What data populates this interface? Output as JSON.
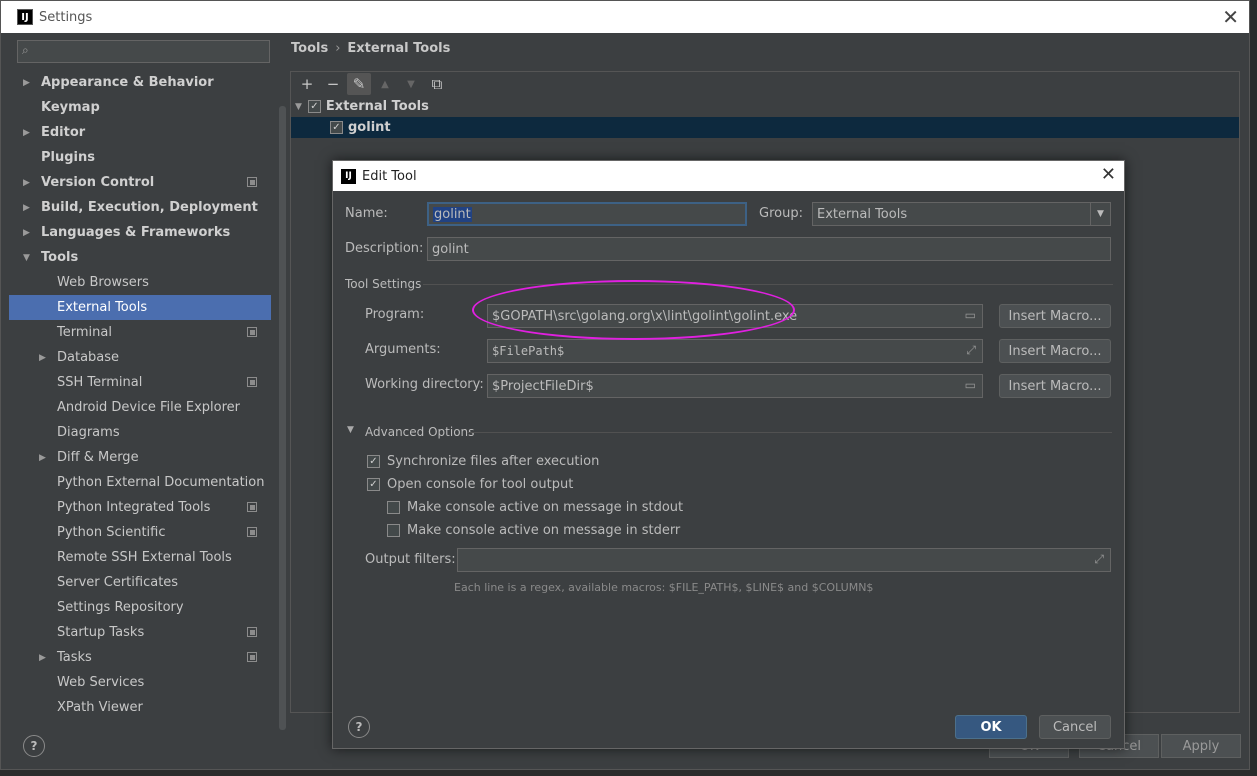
{
  "window": {
    "title": "Settings",
    "app_icon": "IJ"
  },
  "search": {
    "placeholder": ""
  },
  "sidebar": {
    "items": [
      {
        "label": "Appearance & Behavior",
        "level": 0,
        "bold": true,
        "arrow": "right"
      },
      {
        "label": "Keymap",
        "level": 0,
        "bold": true
      },
      {
        "label": "Editor",
        "level": 0,
        "bold": true,
        "arrow": "right"
      },
      {
        "label": "Plugins",
        "level": 0,
        "bold": true
      },
      {
        "label": "Version Control",
        "level": 0,
        "bold": true,
        "arrow": "right",
        "project": true
      },
      {
        "label": "Build, Execution, Deployment",
        "level": 0,
        "bold": true,
        "arrow": "right"
      },
      {
        "label": "Languages & Frameworks",
        "level": 0,
        "bold": true,
        "arrow": "right"
      },
      {
        "label": "Tools",
        "level": 0,
        "bold": true,
        "arrow": "down"
      },
      {
        "label": "Web Browsers",
        "level": 1
      },
      {
        "label": "External Tools",
        "level": 1,
        "selected": true
      },
      {
        "label": "Terminal",
        "level": 1,
        "project": true
      },
      {
        "label": "Database",
        "level": 1,
        "arrow": "right"
      },
      {
        "label": "SSH Terminal",
        "level": 1,
        "project": true
      },
      {
        "label": "Android Device File Explorer",
        "level": 1
      },
      {
        "label": "Diagrams",
        "level": 1
      },
      {
        "label": "Diff & Merge",
        "level": 1,
        "arrow": "right"
      },
      {
        "label": "Python External Documentation",
        "level": 1
      },
      {
        "label": "Python Integrated Tools",
        "level": 1,
        "project": true
      },
      {
        "label": "Python Scientific",
        "level": 1,
        "project": true
      },
      {
        "label": "Remote SSH External Tools",
        "level": 1
      },
      {
        "label": "Server Certificates",
        "level": 1
      },
      {
        "label": "Settings Repository",
        "level": 1
      },
      {
        "label": "Startup Tasks",
        "level": 1,
        "project": true
      },
      {
        "label": "Tasks",
        "level": 1,
        "arrow": "right",
        "project": true
      },
      {
        "label": "Web Services",
        "level": 1
      },
      {
        "label": "XPath Viewer",
        "level": 1
      }
    ]
  },
  "breadcrumb": {
    "parent": "Tools",
    "separator": "›",
    "current": "External Tools"
  },
  "toolbar": {
    "add": "+",
    "remove": "−",
    "edit": "✎",
    "up": "▲",
    "down": "▼",
    "copy": "⧉"
  },
  "tools_tree": {
    "group": {
      "label": "External Tools",
      "checked": true
    },
    "items": [
      {
        "label": "golint",
        "checked": true,
        "selected": true
      }
    ]
  },
  "bottom": {
    "ok": "OK",
    "cancel": "Cancel",
    "apply": "Apply",
    "help": "?"
  },
  "dialog": {
    "title": "Edit Tool",
    "name_label": "Name:",
    "name_value": "golint",
    "group_label": "Group:",
    "group_value": "External Tools",
    "description_label": "Description:",
    "description_value": "golint",
    "tool_settings_title": "Tool Settings",
    "program_label": "Program:",
    "program_value": "$GOPATH\\src\\golang.org\\x\\lint\\golint\\golint.exe",
    "arguments_label": "Arguments:",
    "arguments_value": "$FilePath$",
    "workdir_label": "Working directory:",
    "workdir_value": "$ProjectFileDir$",
    "insert_macro": "Insert Macro...",
    "advanced_title": "Advanced Options",
    "options": [
      {
        "label": "Synchronize files after execution",
        "checked": true,
        "indent": 0
      },
      {
        "label": "Open console for tool output",
        "checked": true,
        "indent": 0
      },
      {
        "label": "Make console active on message in stdout",
        "checked": false,
        "indent": 1
      },
      {
        "label": "Make console active on message in stderr",
        "checked": false,
        "indent": 1
      }
    ],
    "output_filters_label": "Output filters:",
    "output_filters_value": "",
    "hint": "Each line is a regex, available macros: $FILE_PATH$, $LINE$ and $COLUMN$",
    "ok": "OK",
    "cancel": "Cancel",
    "help": "?"
  },
  "colors": {
    "selection": "#4b6eaf",
    "highlight_ellipse": "#e020e0",
    "ok_button": "#365880"
  }
}
